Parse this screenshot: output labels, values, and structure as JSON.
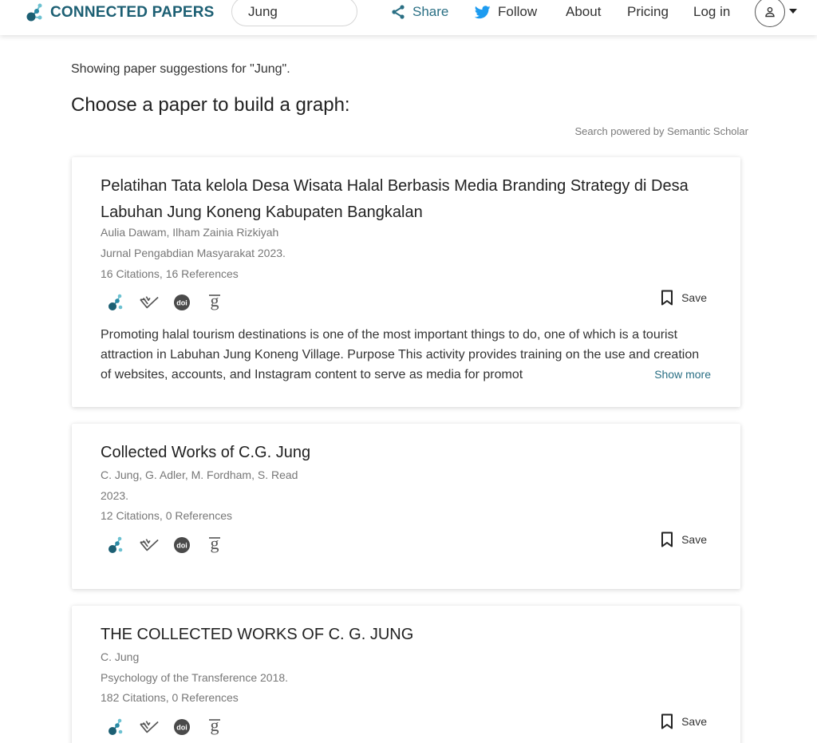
{
  "brand": {
    "name": "CONNECTED PAPERS"
  },
  "search": {
    "value": "Jung"
  },
  "nav": {
    "share": "Share",
    "follow": "Follow",
    "about": "About",
    "pricing": "Pricing",
    "login": "Log in"
  },
  "header": {
    "showing": "Showing paper suggestions for \"Jung\".",
    "choose": "Choose a paper to build a graph:",
    "powered": "Search powered by Semantic Scholar"
  },
  "save_label": "Save",
  "show_more_label": "Show more",
  "colors": {
    "brand": "#1c5f73",
    "accent": "#2a6f84",
    "twitter": "#1d9bf0"
  },
  "icons": [
    "connected-papers-icon",
    "semantic-scholar-icon",
    "doi-icon",
    "google-scholar-icon"
  ],
  "papers": [
    {
      "title": "Pelatihan Tata kelola Desa Wisata Halal Berbasis Media Branding Strategy di Desa Labuhan Jung Koneng Kabupaten Bangkalan",
      "authors": "Aulia Dawam, Ilham Zainia Rizkiyah",
      "venue": "Jurnal Pengabdian Masyarakat 2023.",
      "stats": "16 Citations, 16 References",
      "abstract": "Promoting halal tourism destinations is one of the most important things to do, one of which is a tourist attraction in Labuhan Jung Koneng Village. Purpose This activity provides training on the use and creation of websites, accounts, and Instagram content to serve as media for promot"
    },
    {
      "title": "Collected Works of C.G. Jung",
      "authors": "C. Jung, G. Adler, M. Fordham, S. Read",
      "venue": "2023.",
      "stats": "12 Citations, 0 References"
    },
    {
      "title": "THE COLLECTED WORKS OF C. G. JUNG",
      "authors": "C. Jung",
      "venue": "Psychology of the Transference 2018.",
      "stats": "182 Citations, 0 References"
    }
  ]
}
